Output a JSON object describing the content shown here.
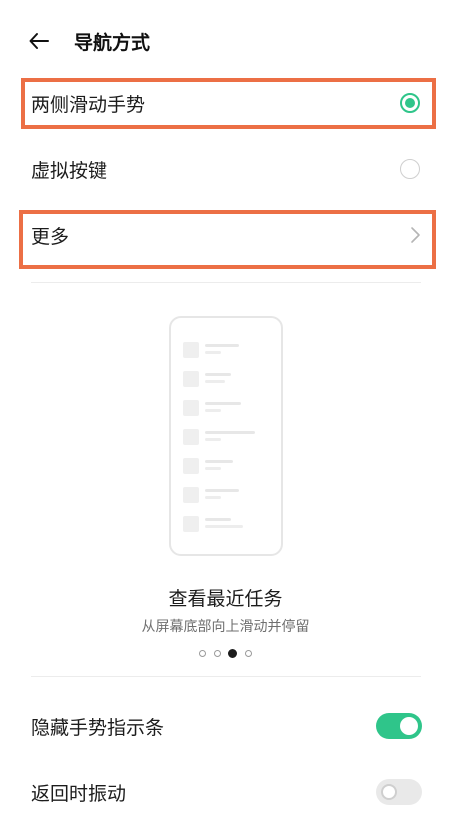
{
  "header": {
    "title": "导航方式",
    "back_icon": "arrow-left-icon"
  },
  "options": [
    {
      "label": "两侧滑动手势",
      "selected": true
    },
    {
      "label": "虚拟按键",
      "selected": false
    }
  ],
  "more": {
    "label": "更多",
    "icon": "chevron-right-icon"
  },
  "preview": {
    "title": "查看最近任务",
    "subtitle": "从屏幕底部向上滑动并停留",
    "page_count": 4,
    "active_page": 3
  },
  "toggles": [
    {
      "label": "隐藏手势指示条",
      "on": true
    },
    {
      "label": "返回时振动",
      "on": false
    }
  ],
  "colors": {
    "accent": "#2fc58a",
    "highlight": "#ec6f45"
  }
}
